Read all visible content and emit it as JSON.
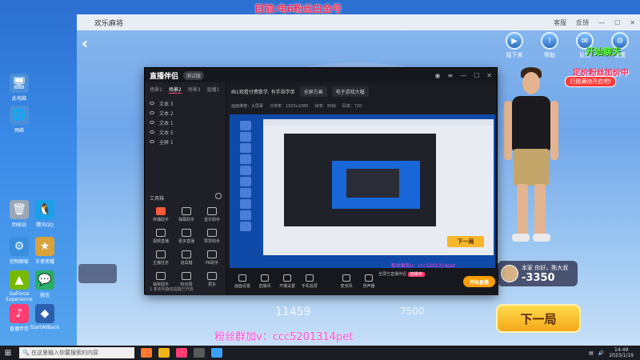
{
  "desktop": {
    "banner": "目前:电6粉丝白金号",
    "icons": [
      {
        "label": "此电脑",
        "icon": "computer-icon",
        "color": "#4a90d9"
      },
      {
        "label": "网络",
        "icon": "network-icon",
        "color": "#4a90d9"
      },
      {
        "label": "回收站",
        "icon": "recycle-bin-icon",
        "color": "#9aa7b5"
      },
      {
        "label": "控制面板",
        "icon": "control-panel-icon",
        "color": "#3a8ee0"
      },
      {
        "label": "GeForce Experience",
        "icon": "geforce-icon",
        "color": "#76b900"
      },
      {
        "label": "微信",
        "icon": "wechat-icon",
        "color": "#2aae67"
      },
      {
        "label": "直播伴侣",
        "icon": "live-companion-icon",
        "color": "#ff3d71"
      },
      {
        "label": "StartAllBack",
        "icon": "app-icon",
        "color": "#2a5fb0"
      },
      {
        "label": "王者荣耀",
        "icon": "game-icon",
        "color": "#d9a23a"
      },
      {
        "label": "腾讯QQ",
        "icon": "qq-icon",
        "color": "#1aa0e8"
      }
    ]
  },
  "game": {
    "title": "欢乐麻将",
    "titlebar_links": [
      "客服",
      "反馈"
    ],
    "top_icons": [
      {
        "label": "接下来",
        "icon": "next-icon"
      },
      {
        "label": "帮助",
        "icon": "help-icon"
      },
      {
        "label": "反馈",
        "icon": "feedback-icon"
      },
      {
        "label": "设置",
        "icon": "settings-icon"
      }
    ],
    "promo_green": "开始聊天",
    "promo_red": "定价粉丝加价中",
    "promo_badge": "已储满快开启吧!",
    "score_left": "11459",
    "score_mid": "7500",
    "player": {
      "name": "本家 你好，陈大叔",
      "score": "-3350"
    },
    "next_round": "下一局"
  },
  "stream_app": {
    "logo": "直播伴侣",
    "version": "测试版",
    "side_tabs": [
      "场景1",
      "场景2",
      "场景3",
      "直播1"
    ],
    "layers": [
      "文本 3",
      "文本 2",
      "文本 1",
      "文本 5",
      "全屏 1"
    ],
    "tools_title": "工具箱",
    "tools": [
      "传播助手",
      "弹幕助手",
      "音乐助手",
      "视频直播",
      "更多直播",
      "赞赏助手",
      "主播任务",
      "道具箱",
      "PK助手",
      "抽奖助手",
      "粉丝团",
      "更多"
    ],
    "side_footer": "1 麦克风静音提醒已开启",
    "main_top": [
      "画1观看付费散学, 有手指学单",
      "全屏方画",
      "电子游戏大幅"
    ],
    "main_sub": [
      "画面推荐：大屏幕",
      "分辨率：1920x1080",
      "帧率：30帧",
      "码率：720"
    ],
    "preview_next": "下一局",
    "preview_pink": "粉丝群加v：ccc5201314pet",
    "bottom_items": [
      "画面设置",
      "直播间",
      "开播设置",
      "手机投屏",
      "麦克风",
      "扬声器"
    ],
    "bottom_status": "全屏已直播伴侣",
    "live_tag": "直播中",
    "start_live": "开始直播"
  },
  "watermark": "粉丝群加v：ccc5201314pet",
  "taskbar": {
    "search_placeholder": "在这里输入你要搜索的内容",
    "time": "14:49",
    "date": "2023/1/19"
  }
}
